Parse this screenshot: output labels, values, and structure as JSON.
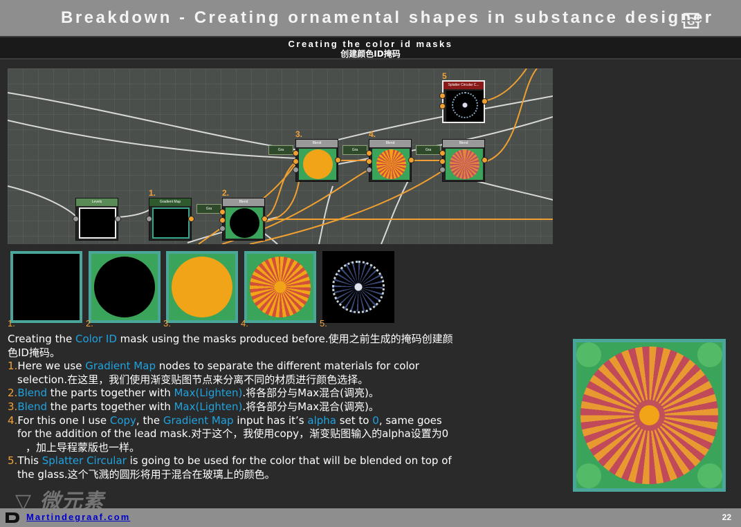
{
  "header": {
    "title": "Breakdown - Creating ornamental shapes in substance designer"
  },
  "subheader": {
    "title_en": "Creating the color id masks",
    "title_cn": "创建颜色ID掩码"
  },
  "graph": {
    "nodes": {
      "levels": "Levels",
      "gradient_map": "Gradient Map",
      "blend_2": "Blend",
      "blend_3": "Blend",
      "blend_4": "Blend",
      "blend_final": "Blend",
      "splatter": "Splatter Circular C..."
    },
    "mini_nodes": [
      "Gra",
      "Gra",
      "Gra",
      "Gra"
    ],
    "step_labels": [
      "1.",
      "2.",
      "3.",
      "4.",
      "5"
    ]
  },
  "thumbnails": {
    "labels": [
      "1.",
      "2.",
      "3.",
      "4.",
      "5."
    ]
  },
  "description": {
    "intro_a": "Creating the ",
    "intro_b": "Color ID",
    "intro_c": " mask using the masks produced before.使用之前生成的掩码创建颜",
    "intro_d": "色ID掩码。",
    "s1_num": "1.",
    "s1_a": "Here we use ",
    "s1_b": "Gradient Map",
    "s1_c": " nodes to separate the different materials for color",
    "s1_d": "selection.在这里，我们使用渐变贴图节点来分离不同的材质进行颜色选择。",
    "s2_num": "2.",
    "s2_a": "Blend",
    "s2_b": " the parts together with ",
    "s2_c": "Max(Lighten)",
    "s2_d": ".将各部分与Max混合(调亮)。",
    "s3_num": "3.",
    "s3_a": "Blend",
    "s3_b": " the parts together with ",
    "s3_c": "Max(Lighten)",
    "s3_d": ".将各部分与Max混合(调亮)。",
    "s4_num": "4.",
    "s4_a": "For this one I use ",
    "s4_b": "Copy",
    "s4_c": ", the ",
    "s4_d": "Gradient Map",
    "s4_e": " input has it’s ",
    "s4_f": "alpha",
    "s4_g": " set to ",
    "s4_h": "0",
    "s4_i": ", same goes",
    "s4_j": "for the addition of the lead mask.对于这个，我使用copy，渐变贴图输入的alpha设置为0",
    "s4_k": "，加上导程蒙版也一样。",
    "s5_num": "5.",
    "s5_a": "This ",
    "s5_b": "Splatter Circular",
    "s5_c": " is going to be used for the color that will be blended on top of",
    "s5_d": "the glass.这个飞溅的圆形将用于混合在玻璃上的颜色。"
  },
  "footer": {
    "link": "Martindegraaf.com",
    "page": "22"
  },
  "colors": {
    "accent_orange": "#f2a33a",
    "highlight_blue": "#1fa3e0",
    "frame_teal": "#4aa69a"
  }
}
